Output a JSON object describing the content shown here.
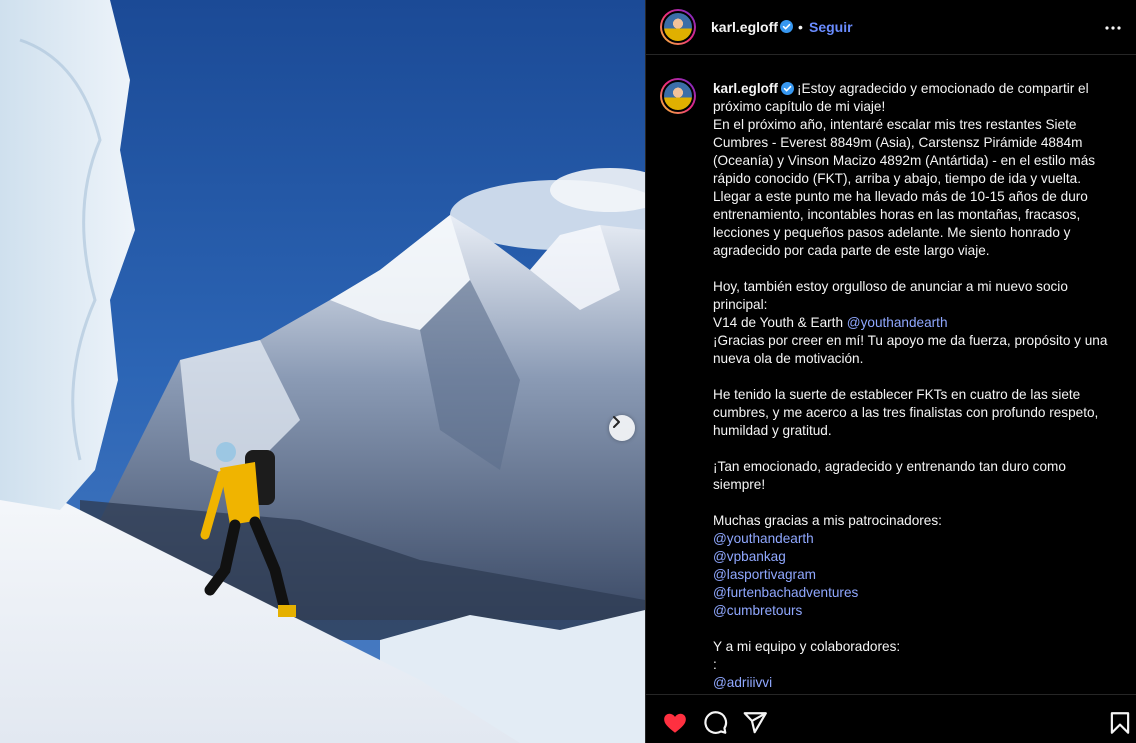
{
  "post": {
    "username": "karl.egloff",
    "separator": "•",
    "follow_label": "Seguir",
    "caption_lead": "¡Estoy agradecido y emocionado de compartir el próximo capítulo de mi viaje!\nEn el próximo año, intentaré escalar mis tres restantes Siete Cumbres - Everest 8849m (Asia), Carstensz Pirámide 4884m (Oceanía) y Vinson Macizo 4892m (Antártida) - en el estilo más rápido conocido (FKT), arriba y abajo, tiempo de ida y vuelta. Llegar a este punto me ha llevado más de 10-15 años de duro entrenamiento, incontables horas en las montañas, fracasos, lecciones y pequeños pasos adelante. Me siento honrado y agradecido por cada parte de este largo viaje.\n\nHoy, también estoy orgulloso de anunciar a mi nuevo socio principal:\nV14 de Youth & Earth ",
    "mention_1": "@youthandearth",
    "caption_mid": "\n¡Gracias por creer en mí! Tu apoyo me da fuerza, propósito y una nueva ola de motivación.\n\nHe tenido la suerte de establecer FKTs en cuatro de las siete cumbres, y me acerco a las tres finalistas con profundo respeto, humildad y gratitud.\n\n¡Tan emocionado, agradecido y entrenando tan duro como siempre!\n\nMuchas gracias a mis patrocinadores:\n",
    "sponsors": [
      "@youthandearth",
      "@vpbankag",
      "@lasportivagram",
      "@furtenbachadventures",
      "@cumbretours"
    ],
    "caption_team": "\nY a mi equipo y colaboradores:\n:\n",
    "team": [
      "@adriiivvi"
    ]
  },
  "icons": {
    "verified": "verified-badge-icon",
    "more": "more-options-icon",
    "next": "chevron-right-icon",
    "like": "heart-icon",
    "comment": "comment-icon",
    "share": "send-icon",
    "save": "bookmark-icon"
  },
  "colors": {
    "accent": "#6a8cff",
    "mention": "#90a8ff",
    "like": "#ff3040",
    "verified": "#3797f0"
  }
}
